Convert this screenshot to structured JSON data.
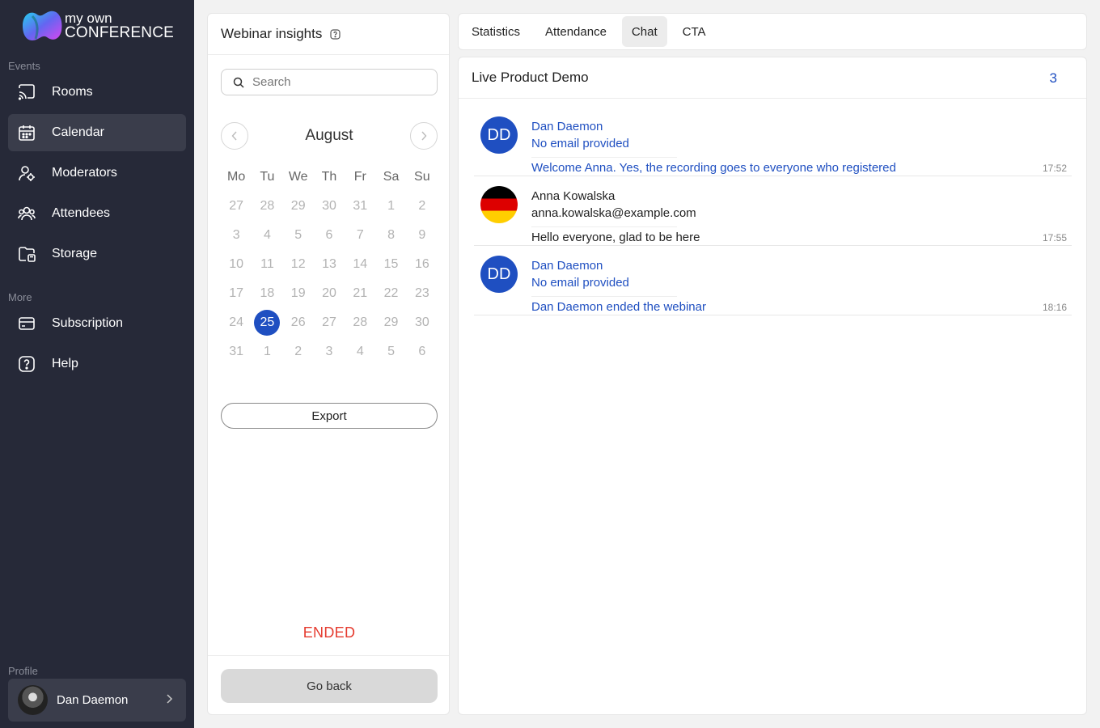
{
  "brand": {
    "line1": "my own",
    "line2": "CONFERENCE"
  },
  "sidebar": {
    "sections": [
      {
        "label": "Events"
      },
      {
        "label": "More"
      },
      {
        "label": "Profile"
      }
    ],
    "items": [
      {
        "label": "Rooms",
        "icon": "cast-icon"
      },
      {
        "label": "Calendar",
        "icon": "calendar-icon",
        "active": true
      },
      {
        "label": "Moderators",
        "icon": "moderator-icon"
      },
      {
        "label": "Attendees",
        "icon": "users-icon"
      },
      {
        "label": "Storage",
        "icon": "folder-icon"
      },
      {
        "label": "Subscription",
        "icon": "card-icon"
      },
      {
        "label": "Help",
        "icon": "help-icon"
      }
    ],
    "profile": {
      "name": "Dan Daemon"
    }
  },
  "insights": {
    "title": "Webinar insights",
    "search_placeholder": "Search",
    "month": "August",
    "weekdays": [
      "Mo",
      "Tu",
      "We",
      "Th",
      "Fr",
      "Sa",
      "Su"
    ],
    "days": [
      "27",
      "28",
      "29",
      "30",
      "31",
      "1",
      "2",
      "3",
      "4",
      "5",
      "6",
      "7",
      "8",
      "9",
      "10",
      "11",
      "12",
      "13",
      "14",
      "15",
      "16",
      "17",
      "18",
      "19",
      "20",
      "21",
      "22",
      "23",
      "24",
      "25",
      "26",
      "27",
      "28",
      "29",
      "30",
      "31",
      "1",
      "2",
      "3",
      "4",
      "5",
      "6"
    ],
    "selected_day": "25",
    "export_label": "Export",
    "status": "ENDED",
    "go_back_label": "Go back"
  },
  "tabs": [
    {
      "label": "Statistics"
    },
    {
      "label": "Attendance"
    },
    {
      "label": "Chat",
      "active": true
    },
    {
      "label": "CTA"
    }
  ],
  "chat": {
    "title": "Live Product Demo",
    "count": "3",
    "messages": [
      {
        "initials": "DD",
        "name": "Dan Daemon",
        "email": "No email provided",
        "text": "Welcome Anna. Yes, the recording goes to everyone who registered",
        "time": "17:52",
        "moderator": true
      },
      {
        "initials": "",
        "name": "Anna Kowalska",
        "email": "anna.kowalska@example.com",
        "text": "Hello everyone, glad to be here",
        "time": "17:55",
        "moderator": false,
        "avatar": "germany-flag-icon"
      },
      {
        "initials": "DD",
        "name": "Dan Daemon",
        "email": "No email provided",
        "text": "Dan Daemon ended the webinar",
        "time": "18:16",
        "moderator": true
      }
    ]
  },
  "colors": {
    "sidebar": "#262938",
    "accent": "#1f4fc1",
    "status_ended": "#e53a2e"
  }
}
